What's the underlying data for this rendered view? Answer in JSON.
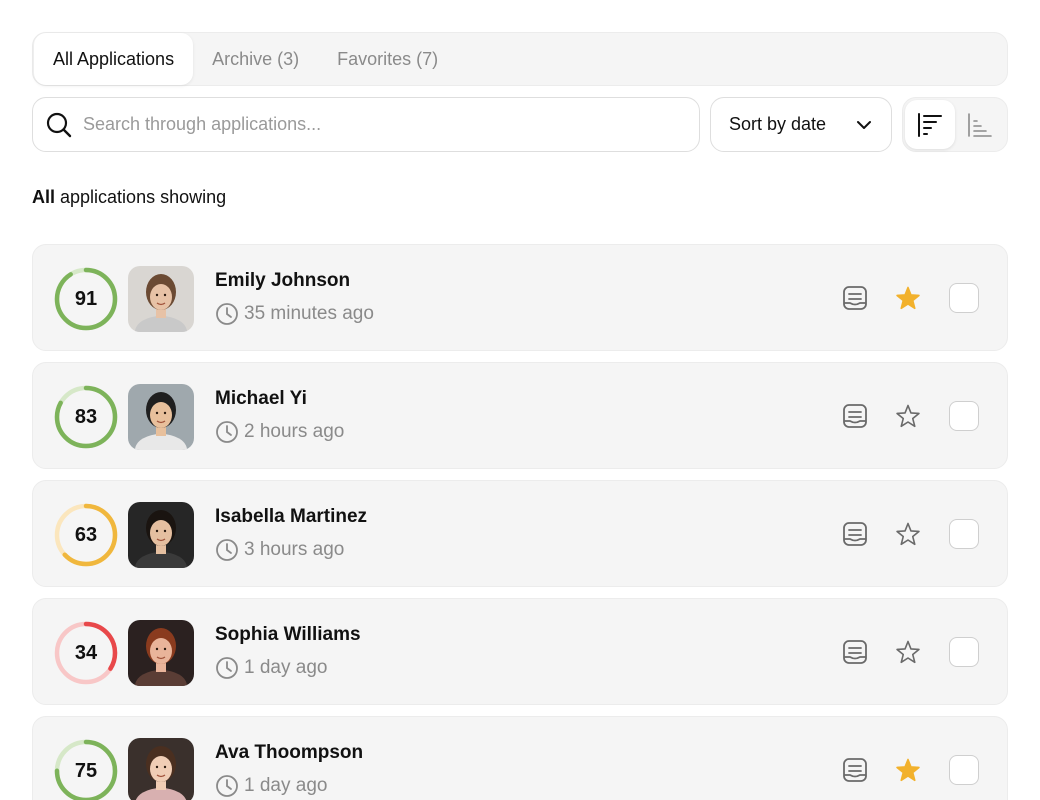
{
  "tabs": [
    {
      "label": "All Applications",
      "active": true
    },
    {
      "label": "Archive (3)",
      "active": false
    },
    {
      "label": "Favorites (7)",
      "active": false
    }
  ],
  "search": {
    "placeholder": "Search through applications...",
    "value": "",
    "icon": "search-icon"
  },
  "sort": {
    "label": "Sort by date",
    "icon": "chevron-down-icon"
  },
  "order": {
    "descending_icon": "sort-descending-icon",
    "ascending_icon": "sort-ascending-icon",
    "active": "descending"
  },
  "status": {
    "bold": "All",
    "rest": " applications showing"
  },
  "colors": {
    "high": "#7db35a",
    "high_track": "#d6e8c8",
    "mid": "#f0b73d",
    "mid_track": "#fbe6bd",
    "low": "#e8484a",
    "low_track": "#f8c7c7",
    "star": "#f2b12c"
  },
  "applications": [
    {
      "score": 91,
      "name": "Emily Johnson",
      "time": "35 minutes ago",
      "favorite": true,
      "level": "high"
    },
    {
      "score": 83,
      "name": "Michael Yi",
      "time": "2 hours ago",
      "favorite": false,
      "level": "high"
    },
    {
      "score": 63,
      "name": "Isabella Martinez",
      "time": "3 hours ago",
      "favorite": false,
      "level": "mid"
    },
    {
      "score": 34,
      "name": "Sophia Williams",
      "time": "1 day ago",
      "favorite": false,
      "level": "low"
    },
    {
      "score": 75,
      "name": "Ava Thoompson",
      "time": "1 day ago",
      "favorite": true,
      "level": "high"
    }
  ]
}
